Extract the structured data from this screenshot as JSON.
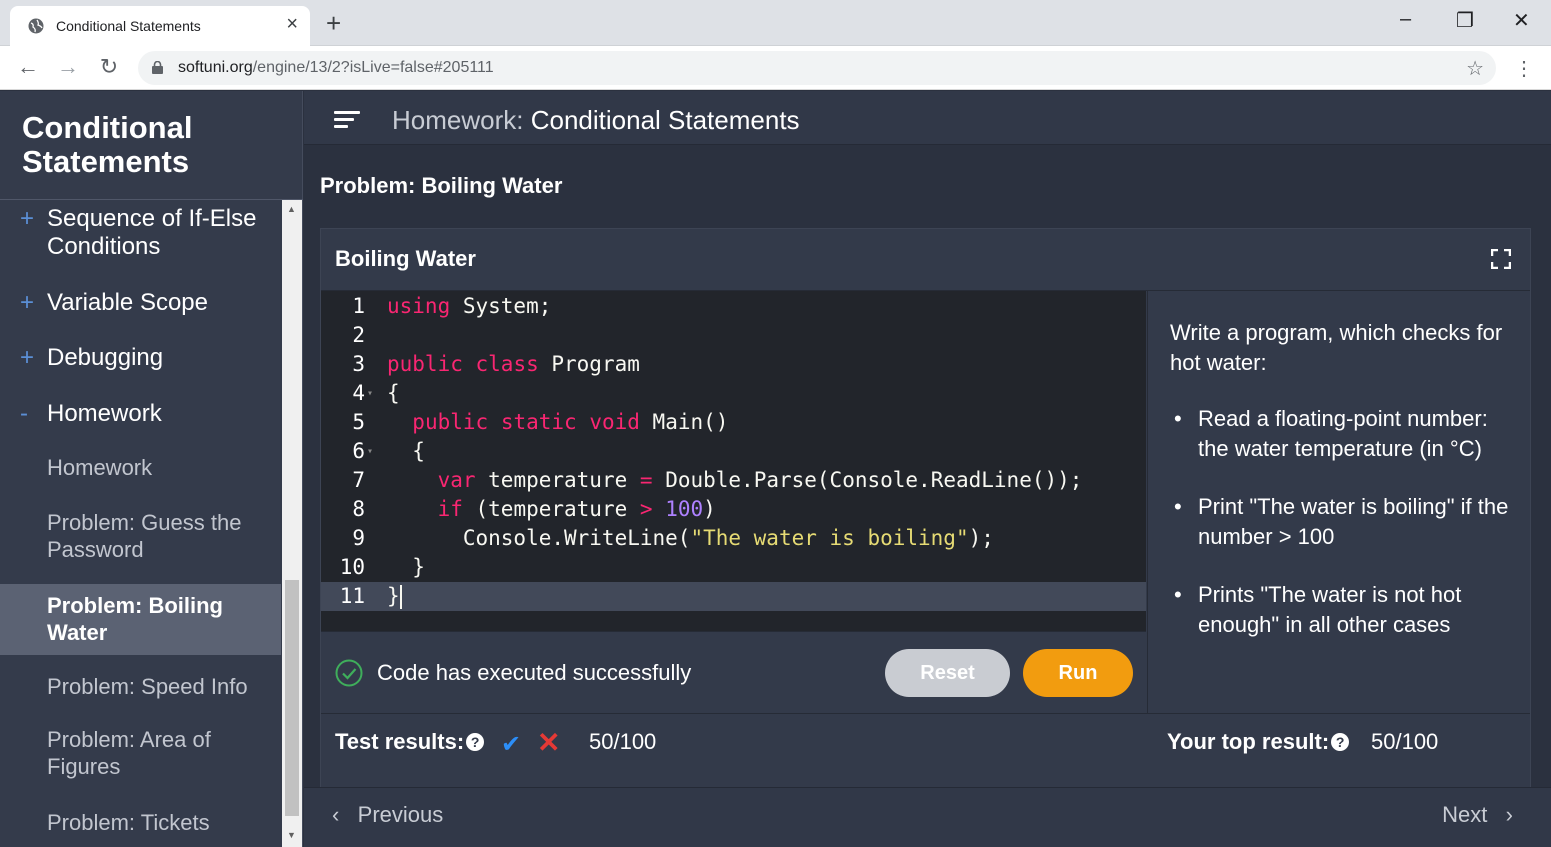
{
  "browser": {
    "tab_title": "Conditional Statements",
    "url_host": "softuni.org",
    "url_path": "/engine/13/2?isLive=false#205111"
  },
  "sidebar": {
    "title": "Conditional Statements",
    "items": [
      {
        "sign": "+",
        "label": "Sequence of If-Else Conditions"
      },
      {
        "sign": "+",
        "label": "Variable Scope"
      },
      {
        "sign": "+",
        "label": "Debugging"
      },
      {
        "sign": "-",
        "label": "Homework"
      }
    ],
    "subitems": [
      {
        "label": "Homework"
      },
      {
        "label": "Problem: Guess the Password"
      },
      {
        "label": "Problem: Boiling Water",
        "active": true
      },
      {
        "label": "Problem: Speed Info"
      },
      {
        "label": "Problem: Area of Figures"
      },
      {
        "label": "Problem: Tickets"
      }
    ]
  },
  "header": {
    "prefix": "Homework:",
    "title": "Conditional Statements"
  },
  "problem_title": "Problem: Boiling Water",
  "panel": {
    "title": "Boiling Water"
  },
  "editor": {
    "line_numbers": [
      "1",
      "2",
      "3",
      "4",
      "5",
      "6",
      "7",
      "8",
      "9",
      "10",
      "11"
    ],
    "lines": [
      "using System;",
      "",
      "public class Program",
      "{",
      "  public static void Main()",
      "  {",
      "    var temperature = Double.Parse(Console.ReadLine());",
      "    if (temperature > 100)",
      "      Console.WriteLine(\"The water is boiling\");",
      "  }",
      "}"
    ]
  },
  "run": {
    "message": "Code has executed successfully",
    "reset_label": "Reset",
    "run_label": "Run"
  },
  "description": {
    "intro": "Write a program, which checks for hot water:",
    "bullets": [
      "Read a floating-point number: the water temperature (in °C)",
      "Print \"The water is boiling\" if the number > 100",
      "Prints \"The water is not hot enough\" in all other cases"
    ]
  },
  "results": {
    "test_label": "Test results:",
    "test_score": "50/100",
    "top_label": "Your top result:",
    "top_score": "50/100"
  },
  "footer": {
    "prev_label": "Previous",
    "next_label": "Next"
  },
  "colors": {
    "accent_run": "#f29c0f",
    "success": "#3fae5b",
    "sidebar_bg": "#343b4b",
    "main_bg": "#2b313f"
  }
}
